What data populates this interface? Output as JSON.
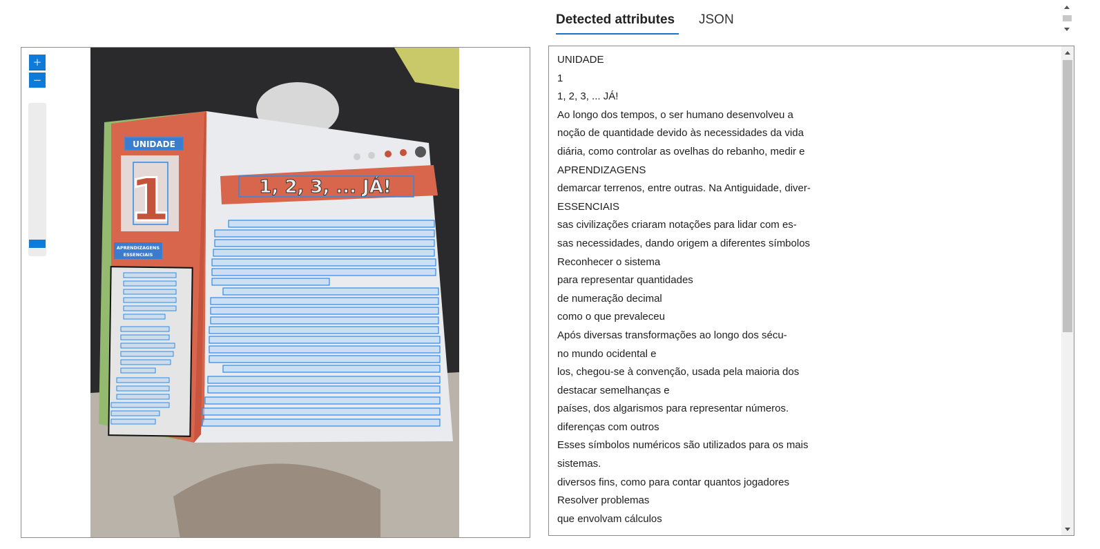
{
  "tabs": [
    {
      "label": "Detected attributes",
      "active": true
    },
    {
      "label": "JSON",
      "active": false
    }
  ],
  "zoom": {
    "in_label": "+",
    "out_label": "−",
    "level": 0.1
  },
  "photo": {
    "unit_badge": "UNIDADE",
    "unit_number": "1",
    "title": "1, 2, 3, ... JÁ!",
    "side_label": "APRENDIZAGENS ESSENCIAIS"
  },
  "detected_lines": [
    "UNIDADE",
    "1",
    "1, 2, 3, ... JÁ!",
    "Ao longo dos tempos, o ser humano desenvolveu a",
    "noção de quantidade devido às necessidades da vida",
    "diária, como controlar as ovelhas do rebanho, medir e",
    "APRENDIZAGENS",
    "demarcar terrenos, entre outras. Na Antiguidade, diver-",
    "ESSENCIAIS",
    "sas civilizações criaram notações para lidar com es-",
    "sas necessidades, dando origem a diferentes símbolos",
    "Reconhecer o sistema",
    "para representar quantidades",
    "de numeração decimal",
    "como o que prevaleceu",
    "Após diversas transformações ao longo dos sécu-",
    "no mundo ocidental e",
    "los, chegou-se à convenção, usada pela maioria dos",
    "destacar semelhanças e",
    "países, dos algarismos para representar números.",
    "diferenças com outros",
    "Esses símbolos numéricos são utilizados para os mais",
    "sistemas.",
    "diversos fins, como para contar quantos jogadores",
    "Resolver problemas",
    "que envolvam cálculos"
  ],
  "colors": {
    "accent": "#1a73c8",
    "zoom_button": "#0f7bd8",
    "detection_box": "#2b8be8"
  }
}
